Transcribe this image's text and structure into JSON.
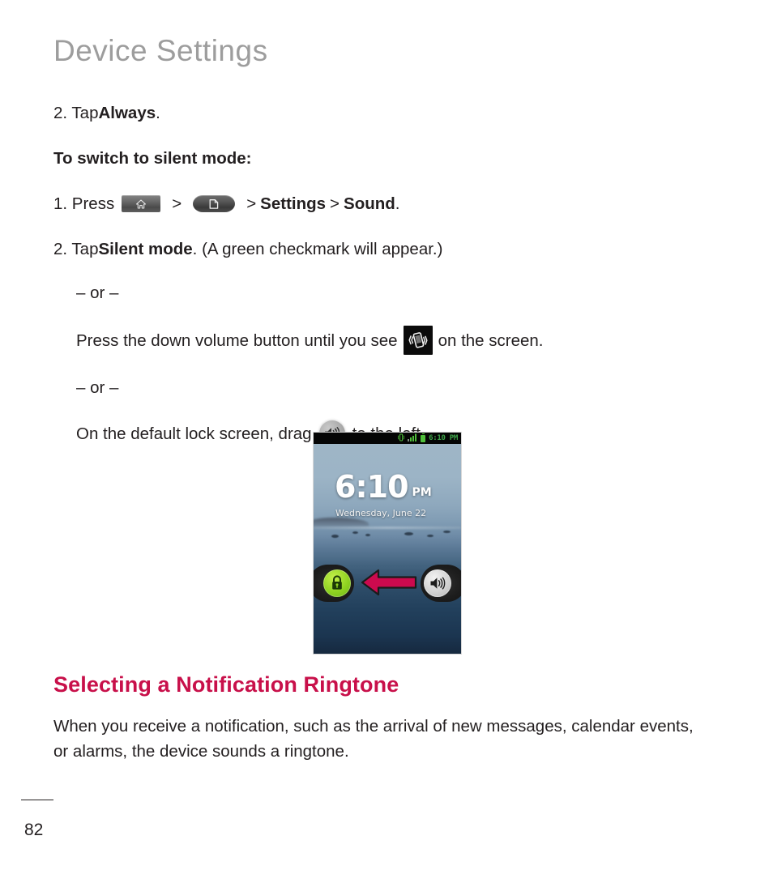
{
  "page": {
    "title": "Device Settings",
    "number": "82"
  },
  "steps": {
    "step_always_prefix": "2. Tap ",
    "step_always_bold": "Always",
    "step_always_suffix": ".",
    "subheading_silent": "To switch to silent mode:",
    "press_prefix": "1. Press",
    "gt1": ">",
    "gt2": ">",
    "settings_label": "Settings",
    "gt3": ">",
    "sound_label": "Sound",
    "sound_suffix": ".",
    "silent_prefix": "2. Tap ",
    "silent_bold": "Silent mode",
    "silent_suffix": ". (A green checkmark will appear.)",
    "or_1": "– or –",
    "volume_prefix": "Press the down volume button until you see",
    "volume_suffix": "on the screen.",
    "or_2": "– or –",
    "lockscreen_prefix": "On the default lock screen, drag",
    "lockscreen_suffix": "to the left."
  },
  "icons": {
    "home_key": "home-key-icon",
    "menu_key": "menu-key-icon",
    "vibrate": "vibrate-icon",
    "sound": "sound-icon"
  },
  "phone_screenshot": {
    "status_bar": {
      "clock": "6:10 PM",
      "vibrate_icon": "vibrate-status-icon",
      "signal_icon": "signal-bars-icon",
      "battery_icon": "battery-icon"
    },
    "lock_screen": {
      "time": "6:10",
      "ampm": "PM",
      "date": "Wednesday, June 22",
      "left_knob": "lock-icon",
      "right_knob": "sound-knob-icon",
      "arrow": "drag-left-arrow"
    }
  },
  "section": {
    "heading": "Selecting a Notification Ringtone",
    "body": "When you receive a notification, such as the arrival of new messages, calendar events, or alarms, the device sounds a ringtone."
  },
  "colors": {
    "heading_accent": "#c8104a",
    "title_gray": "#9d9d9d",
    "body_text": "#231f20",
    "arrow": "#cc0a4e",
    "lock_green": "#8fd321"
  }
}
